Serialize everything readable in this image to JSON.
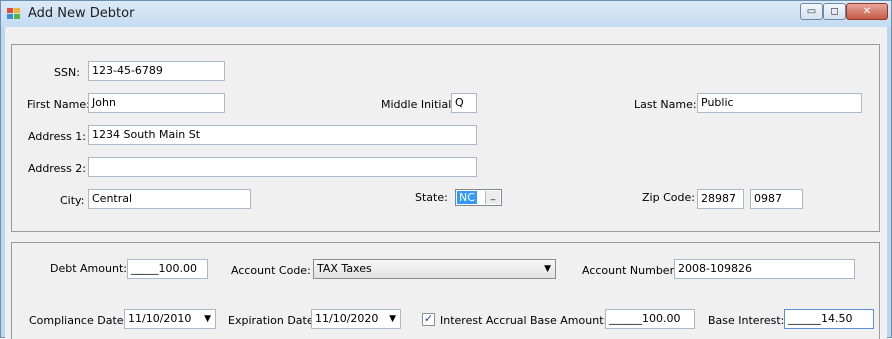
{
  "window": {
    "title": "Add New Debtor",
    "controls": {
      "minimize": "▭",
      "maximize": "◻",
      "close": "✕"
    }
  },
  "person": {
    "ssn": {
      "label": "SSN:",
      "value": "123-45-6789"
    },
    "first_name": {
      "label": "First Name:",
      "value": "John"
    },
    "middle_initial": {
      "label": "Middle Initial:",
      "value": "Q"
    },
    "last_name": {
      "label": "Last Name:",
      "value": "Public"
    },
    "address1": {
      "label": "Address 1:",
      "value": "1234 South Main St"
    },
    "address2": {
      "label": "Address 2:",
      "value": ""
    },
    "city": {
      "label": "City:",
      "value": "Central"
    },
    "state": {
      "label": "State:",
      "value": "NC",
      "spin_icon": "spin-icon"
    },
    "zip": {
      "label": "Zip Code:",
      "value": "28987",
      "ext": "0987"
    }
  },
  "debt": {
    "debt_amount": {
      "label": "Debt Amount:",
      "value": "_____100.00"
    },
    "account_code": {
      "label": "Account Code:",
      "value": "TAX Taxes"
    },
    "account_number": {
      "label": "Account Number:",
      "value": "2008-109826"
    },
    "compliance_date": {
      "label": "Compliance Date:",
      "value": "11/10/2010"
    },
    "expiration_date": {
      "label": "Expiration Date:",
      "value": "11/10/2020"
    },
    "interest_accrual": {
      "label": "Interest Accrual",
      "checked": true
    },
    "base_amount": {
      "label": "Base Amount:",
      "value": "______100.00"
    },
    "base_interest": {
      "label": "Base Interest:",
      "value": "______14.50"
    }
  },
  "colors": {
    "selection": "#3399ff",
    "title_bar": "#c4dbf1",
    "form_bg": "#f0f0f0"
  }
}
